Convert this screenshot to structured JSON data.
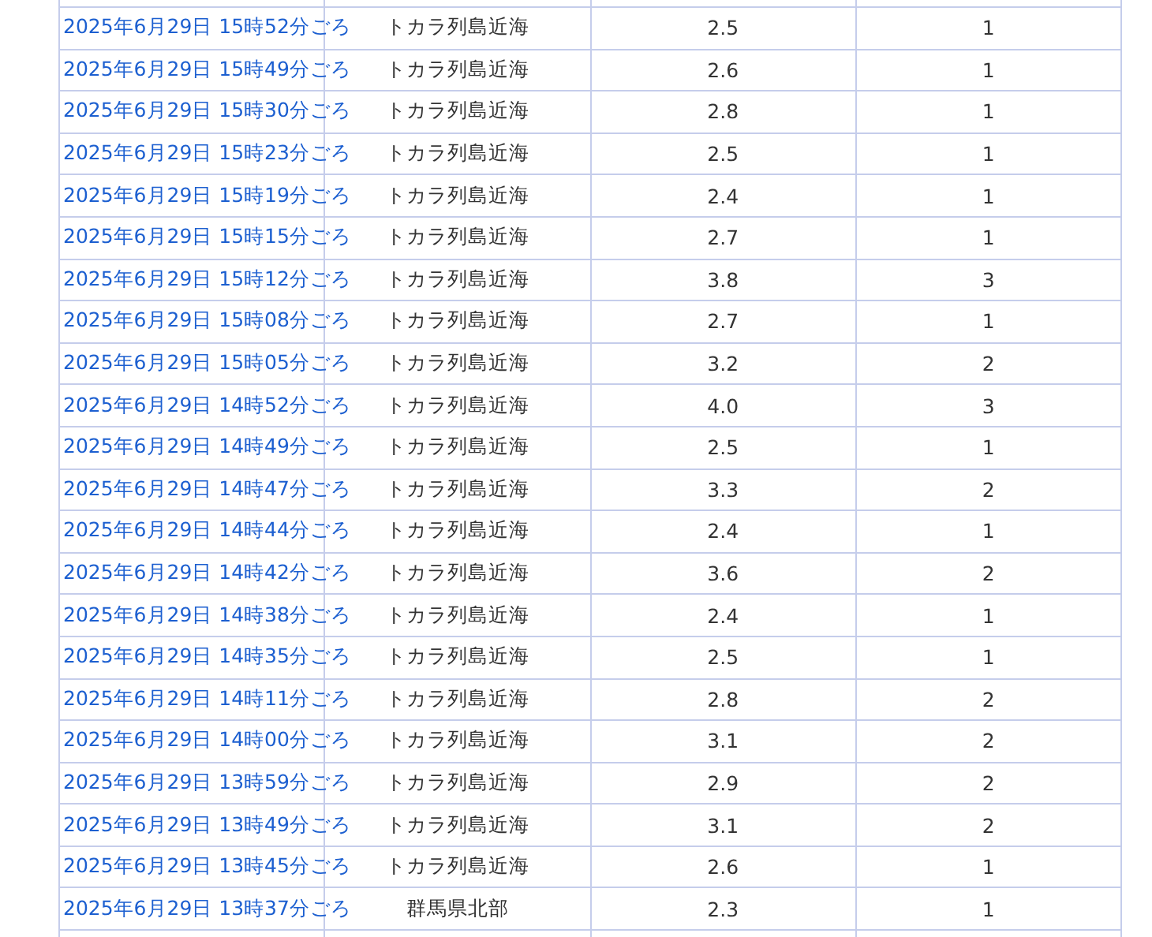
{
  "rows": [
    {
      "time": "2025年6月29日 15時52分ごろ",
      "place": "トカラ列島近海",
      "magnitude": "2.5",
      "intensity": "1"
    },
    {
      "time": "2025年6月29日 15時49分ごろ",
      "place": "トカラ列島近海",
      "magnitude": "2.6",
      "intensity": "1"
    },
    {
      "time": "2025年6月29日 15時30分ごろ",
      "place": "トカラ列島近海",
      "magnitude": "2.8",
      "intensity": "1"
    },
    {
      "time": "2025年6月29日 15時23分ごろ",
      "place": "トカラ列島近海",
      "magnitude": "2.5",
      "intensity": "1"
    },
    {
      "time": "2025年6月29日 15時19分ごろ",
      "place": "トカラ列島近海",
      "magnitude": "2.4",
      "intensity": "1"
    },
    {
      "time": "2025年6月29日 15時15分ごろ",
      "place": "トカラ列島近海",
      "magnitude": "2.7",
      "intensity": "1"
    },
    {
      "time": "2025年6月29日 15時12分ごろ",
      "place": "トカラ列島近海",
      "magnitude": "3.8",
      "intensity": "3"
    },
    {
      "time": "2025年6月29日 15時08分ごろ",
      "place": "トカラ列島近海",
      "magnitude": "2.7",
      "intensity": "1"
    },
    {
      "time": "2025年6月29日 15時05分ごろ",
      "place": "トカラ列島近海",
      "magnitude": "3.2",
      "intensity": "2"
    },
    {
      "time": "2025年6月29日 14時52分ごろ",
      "place": "トカラ列島近海",
      "magnitude": "4.0",
      "intensity": "3"
    },
    {
      "time": "2025年6月29日 14時49分ごろ",
      "place": "トカラ列島近海",
      "magnitude": "2.5",
      "intensity": "1"
    },
    {
      "time": "2025年6月29日 14時47分ごろ",
      "place": "トカラ列島近海",
      "magnitude": "3.3",
      "intensity": "2"
    },
    {
      "time": "2025年6月29日 14時44分ごろ",
      "place": "トカラ列島近海",
      "magnitude": "2.4",
      "intensity": "1"
    },
    {
      "time": "2025年6月29日 14時42分ごろ",
      "place": "トカラ列島近海",
      "magnitude": "3.6",
      "intensity": "2"
    },
    {
      "time": "2025年6月29日 14時38分ごろ",
      "place": "トカラ列島近海",
      "magnitude": "2.4",
      "intensity": "1"
    },
    {
      "time": "2025年6月29日 14時35分ごろ",
      "place": "トカラ列島近海",
      "magnitude": "2.5",
      "intensity": "1"
    },
    {
      "time": "2025年6月29日 14時11分ごろ",
      "place": "トカラ列島近海",
      "magnitude": "2.8",
      "intensity": "2"
    },
    {
      "time": "2025年6月29日 14時00分ごろ",
      "place": "トカラ列島近海",
      "magnitude": "3.1",
      "intensity": "2"
    },
    {
      "time": "2025年6月29日 13時59分ごろ",
      "place": "トカラ列島近海",
      "magnitude": "2.9",
      "intensity": "2"
    },
    {
      "time": "2025年6月29日 13時49分ごろ",
      "place": "トカラ列島近海",
      "magnitude": "3.1",
      "intensity": "2"
    },
    {
      "time": "2025年6月29日 13時45分ごろ",
      "place": "トカラ列島近海",
      "magnitude": "2.6",
      "intensity": "1"
    },
    {
      "time": "2025年6月29日 13時37分ごろ",
      "place": "群馬県北部",
      "magnitude": "2.3",
      "intensity": "1"
    }
  ]
}
